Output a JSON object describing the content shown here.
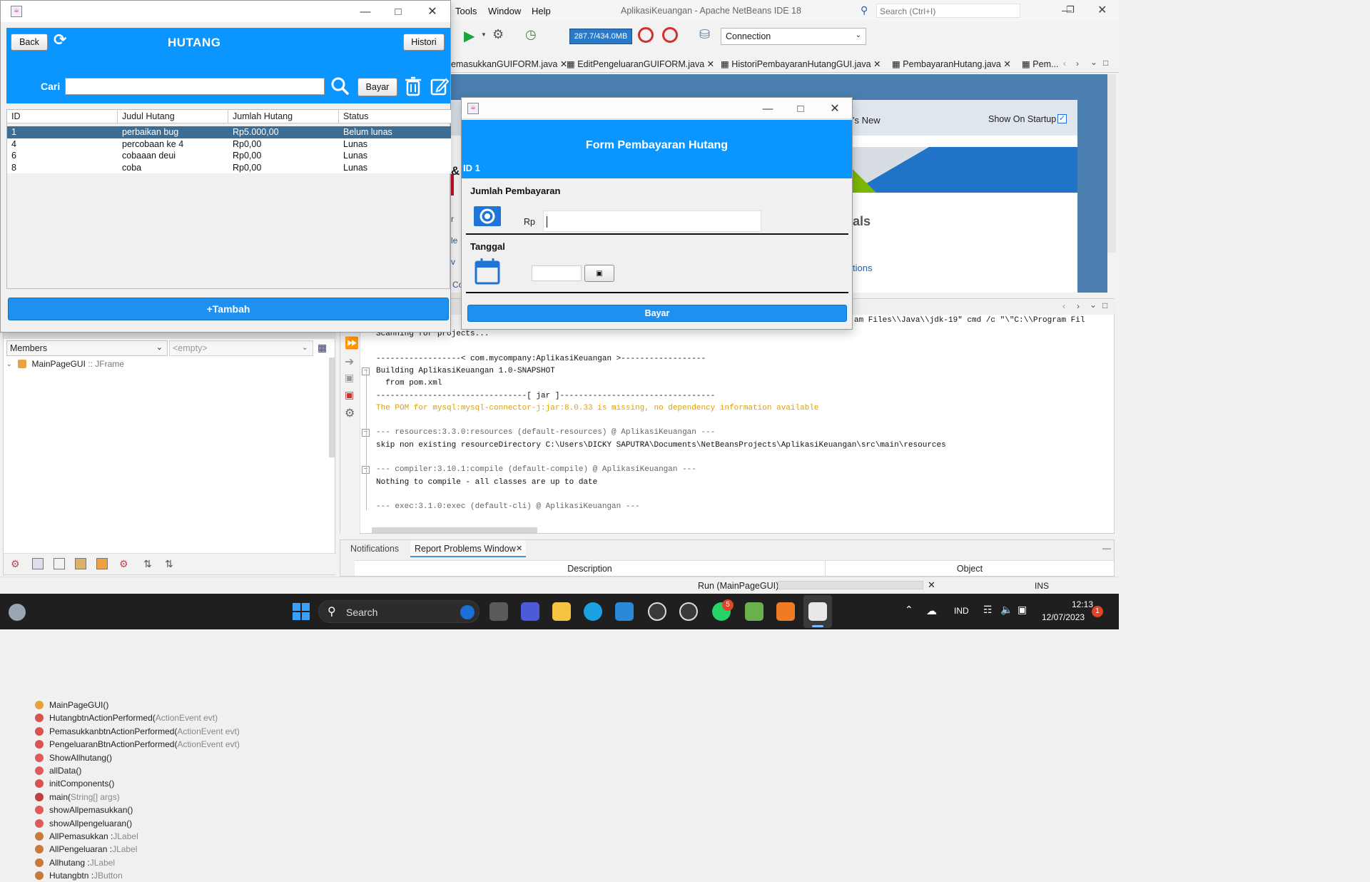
{
  "ide": {
    "menu": [
      "Tools",
      "Window",
      "Help"
    ],
    "title": "AplikasiKeuangan - Apache NetBeans IDE 18",
    "search_placeholder": "Search (Ctrl+I)",
    "memory": "287.7/434.0MB",
    "connection": "Connection",
    "tabs": [
      "emasukkanGUIFORM.java",
      "EditPengeluaranGUIFORM.java",
      "HistoriPembayaranHutangGUI.java",
      "PembayaranHutang.java",
      "Pem..."
    ],
    "start_page": {
      "whats_new": "'s New",
      "show_on_startup": "Show On Startup",
      "tutorials": "als",
      "options": "tions",
      "partial_r": "r",
      "partial_le": "le",
      "partial_v": "v",
      "partial_co": "Co",
      "partial_and": "&"
    },
    "navigator": {
      "members_select": "Members",
      "empty_select": "<empty>",
      "root": {
        "name": "MainPageGUI",
        "type": ":: JFrame"
      },
      "items": [
        {
          "name": "MainPageGUI()",
          "suffix": "",
          "color": "#e8a23a"
        },
        {
          "name": "HutangbtnActionPerformed(",
          "suffix": "ActionEvent evt)",
          "color": "#d9534f"
        },
        {
          "name": "PemasukkanbtnActionPerformed(",
          "suffix": "ActionEvent evt)",
          "color": "#d9534f"
        },
        {
          "name": "PengeluaranBtnActionPerformed(",
          "suffix": "ActionEvent evt)",
          "color": "#d9534f"
        },
        {
          "name": "ShowAllhutang()",
          "suffix": "",
          "color": "#e05a5a"
        },
        {
          "name": "allData()",
          "suffix": "",
          "color": "#e05a5a"
        },
        {
          "name": "initComponents()",
          "suffix": "",
          "color": "#d9534f"
        },
        {
          "name": "main(",
          "suffix": "String[] args)",
          "color": "#c04040"
        },
        {
          "name": "showAllpemasukkan()",
          "suffix": "",
          "color": "#e05a5a"
        },
        {
          "name": "showAllpengeluaran()",
          "suffix": "",
          "color": "#e05a5a"
        },
        {
          "name": "AllPemasukkan : ",
          "suffix": "JLabel",
          "color": "#c87a3a"
        },
        {
          "name": "AllPengeluaran : ",
          "suffix": "JLabel",
          "color": "#c87a3a"
        },
        {
          "name": "Allhutang : ",
          "suffix": "JLabel",
          "color": "#c87a3a"
        },
        {
          "name": "Hutangbtn : ",
          "suffix": "JButton",
          "color": "#c87a3a"
        }
      ]
    },
    "output": {
      "header_partial": "am Files\\\\Java\\\\jdk-19\" cmd /c \"\\\"C:\\\\Program Fil",
      "lines": [
        {
          "text": "Scanning for projects...",
          "color": "#111"
        },
        {
          "text": "",
          "color": "#111"
        },
        {
          "text": "------------------< com.mycompany:AplikasiKeuangan >------------------",
          "color": "#111"
        },
        {
          "text": "Building AplikasiKeuangan 1.0-SNAPSHOT",
          "color": "#111"
        },
        {
          "text": "  from pom.xml",
          "color": "#111"
        },
        {
          "text": "--------------------------------[ jar ]---------------------------------",
          "color": "#111"
        },
        {
          "text": "The POM for mysql:mysql-connector-j:jar:8.0.33 is missing, no dependency information available",
          "color": "#e0a000"
        },
        {
          "text": "",
          "color": "#111"
        },
        {
          "text": "--- resources:3.3.0:resources (default-resources) @ AplikasiKeuangan ---",
          "color": "#666"
        },
        {
          "text": "skip non existing resourceDirectory C:\\Users\\DICKY SAPUTRA\\Documents\\NetBeansProjects\\AplikasiKeuangan\\src\\main\\resources",
          "color": "#111"
        },
        {
          "text": "",
          "color": "#111"
        },
        {
          "text": "--- compiler:3.10.1:compile (default-compile) @ AplikasiKeuangan ---",
          "color": "#666"
        },
        {
          "text": "Nothing to compile - all classes are up to date",
          "color": "#111"
        },
        {
          "text": "",
          "color": "#111"
        },
        {
          "text": "--- exec:3.1.0:exec (default-cli) @ AplikasiKeuangan ---",
          "color": "#666"
        }
      ]
    },
    "bottom_tabs": {
      "notifications": "Notifications",
      "report": "Report Problems Window"
    },
    "problems_columns": [
      "Description",
      "Object"
    ],
    "status": {
      "run": "Run (MainPageGUI)",
      "mode": "INS"
    }
  },
  "hutang": {
    "title": "HUTANG",
    "back": "Back",
    "histori": "Histori",
    "cari_label": "Cari",
    "search_value": "",
    "bayar": "Bayar",
    "columns": [
      "ID",
      "Judul Hutang",
      "Jumlah Hutang",
      "Status"
    ],
    "rows": [
      [
        "1",
        "perbaikan bug",
        "Rp5.000,00",
        "Belum lunas"
      ],
      [
        "4",
        "percobaan ke 4",
        "Rp0,00",
        "Lunas"
      ],
      [
        "6",
        "cobaaan deui",
        "Rp0,00",
        "Lunas"
      ],
      [
        "8",
        "coba",
        "Rp0,00",
        "Lunas"
      ]
    ],
    "tambah": "+Tambah"
  },
  "payment": {
    "title": "Form Pembayaran Hutang",
    "id_label": "ID 1",
    "jumlah_label": "Jumlah Pembayaran",
    "rp_label": "Rp",
    "amount_value": "",
    "tanggal_label": "Tanggal",
    "date_value": "",
    "bayar": "Bayar"
  },
  "taskbar": {
    "search": "Search",
    "lang": "IND",
    "time": "12:13",
    "date": "12/07/2023",
    "notif_count": "1",
    "whatsapp_badge": "5"
  },
  "colors": {
    "accent_blue": "#0a95ff",
    "button_blue": "#1e90f0",
    "selected_row": "#3c6d95",
    "ide_blue": "#1f74c8"
  }
}
